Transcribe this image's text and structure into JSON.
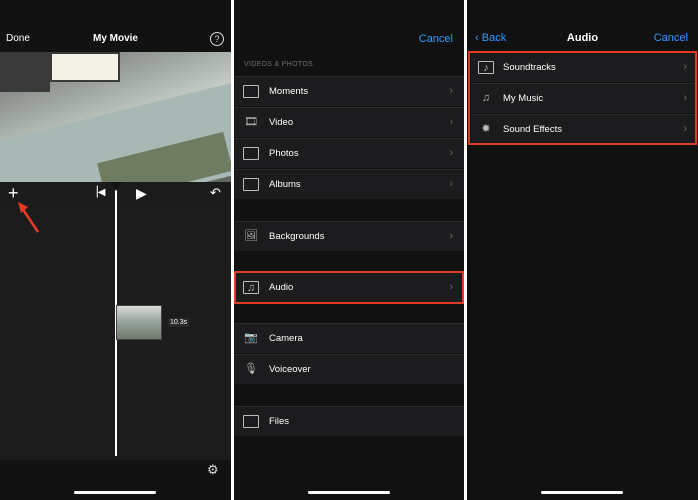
{
  "editor": {
    "done_label": "Done",
    "title": "My Movie",
    "help_icon": "?",
    "clip_duration": "10.3s"
  },
  "media_picker": {
    "cancel_label": "Cancel",
    "section_label": "VIDEOS & PHOTOS",
    "items": [
      {
        "label": "Moments",
        "icon": "moments-icon"
      },
      {
        "label": "Video",
        "icon": "film-icon"
      },
      {
        "label": "Photos",
        "icon": "photo-frame-icon"
      },
      {
        "label": "Albums",
        "icon": "album-icon"
      },
      {
        "label": "Backgrounds",
        "icon": "backgrounds-icon"
      },
      {
        "label": "Audio",
        "icon": "audio-icon"
      },
      {
        "label": "Camera",
        "icon": "camera-icon"
      },
      {
        "label": "Voiceover",
        "icon": "microphone-icon"
      },
      {
        "label": "Files",
        "icon": "folder-icon"
      }
    ]
  },
  "audio_screen": {
    "back_label": "Back",
    "title": "Audio",
    "cancel_label": "Cancel",
    "items": [
      {
        "label": "Soundtracks",
        "icon": "soundtracks-icon"
      },
      {
        "label": "My Music",
        "icon": "music-note-icon"
      },
      {
        "label": "Sound Effects",
        "icon": "sound-effects-icon"
      }
    ]
  },
  "colors": {
    "accent": "#2f9bff",
    "highlight": "#e23b23",
    "background": "#111111",
    "row": "#1c1c1e"
  }
}
